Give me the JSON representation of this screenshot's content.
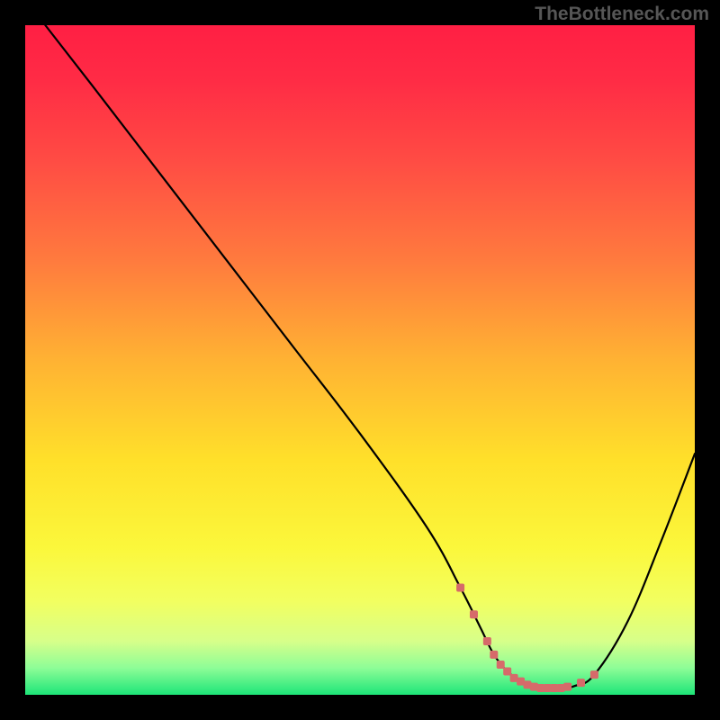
{
  "watermark": "TheBottleneck.com",
  "chart_data": {
    "type": "line",
    "title": "",
    "xlabel": "",
    "ylabel": "",
    "xlim": [
      0,
      100
    ],
    "ylim": [
      0,
      100
    ],
    "series": [
      {
        "name": "curve",
        "x": [
          3,
          10,
          20,
          30,
          40,
          50,
          60,
          65,
          68,
          70,
          72,
          74,
          76,
          78,
          80,
          82,
          85,
          90,
          95,
          100
        ],
        "y": [
          100,
          91,
          78,
          65,
          52,
          39,
          25,
          16,
          10,
          6,
          3.5,
          2,
          1.2,
          1,
          1,
          1.3,
          3,
          11,
          23,
          36
        ]
      }
    ],
    "flat_region_markers": {
      "color": "#d66a6a",
      "x": [
        65,
        67,
        69,
        70,
        71,
        72,
        73,
        74,
        75,
        76,
        77,
        78,
        79,
        80,
        81,
        83,
        85
      ],
      "y": [
        16,
        12,
        8,
        6,
        4.5,
        3.5,
        2.5,
        2,
        1.5,
        1.2,
        1,
        1,
        1,
        1,
        1.2,
        1.8,
        3
      ]
    },
    "gradient_stops": [
      {
        "offset": 0.0,
        "color": "#ff1f44"
      },
      {
        "offset": 0.08,
        "color": "#ff2b45"
      },
      {
        "offset": 0.2,
        "color": "#ff4b44"
      },
      {
        "offset": 0.35,
        "color": "#ff7a3e"
      },
      {
        "offset": 0.5,
        "color": "#ffb233"
      },
      {
        "offset": 0.65,
        "color": "#ffe02a"
      },
      {
        "offset": 0.78,
        "color": "#fbf73b"
      },
      {
        "offset": 0.86,
        "color": "#f2ff60"
      },
      {
        "offset": 0.92,
        "color": "#d7ff8a"
      },
      {
        "offset": 0.96,
        "color": "#8dfd97"
      },
      {
        "offset": 1.0,
        "color": "#1de578"
      }
    ]
  }
}
